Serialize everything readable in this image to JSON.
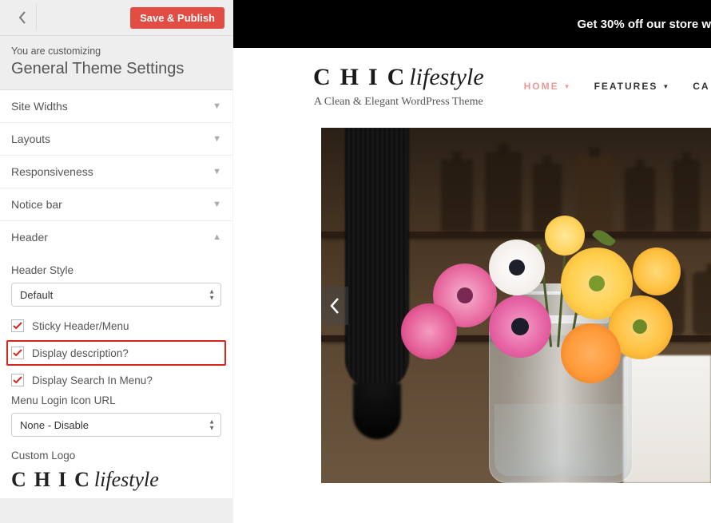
{
  "sidebar": {
    "save_label": "Save & Publish",
    "info_small": "You are customizing",
    "info_title": "General Theme Settings",
    "sections": {
      "site_widths": "Site Widths",
      "layouts": "Layouts",
      "responsiveness": "Responsiveness",
      "notice_bar": "Notice bar",
      "header": "Header"
    },
    "header_panel": {
      "style_label": "Header Style",
      "style_value": "Default",
      "sticky_label": "Sticky Header/Menu",
      "display_desc_label": "Display description?",
      "display_search_label": "Display Search In Menu?",
      "menu_login_label": "Menu Login Icon URL",
      "menu_login_value": "None - Disable",
      "custom_logo_label": "Custom Logo",
      "logo_chic": "CHIC",
      "logo_life": "lifestyle",
      "sticky_checked": true,
      "display_desc_checked": true,
      "display_search_checked": true
    }
  },
  "preview": {
    "promo": "Get 30% off our store w",
    "brand_chic": "CHIC",
    "brand_life": "lifestyle",
    "tagline": "A Clean & Elegant WordPress Theme",
    "nav": {
      "home": "HOME",
      "features": "FEATURES",
      "last": "CA"
    }
  },
  "colors": {
    "accent_button": "#e14d43",
    "highlight_border": "#d9261c",
    "nav_active": "#e89a96"
  }
}
